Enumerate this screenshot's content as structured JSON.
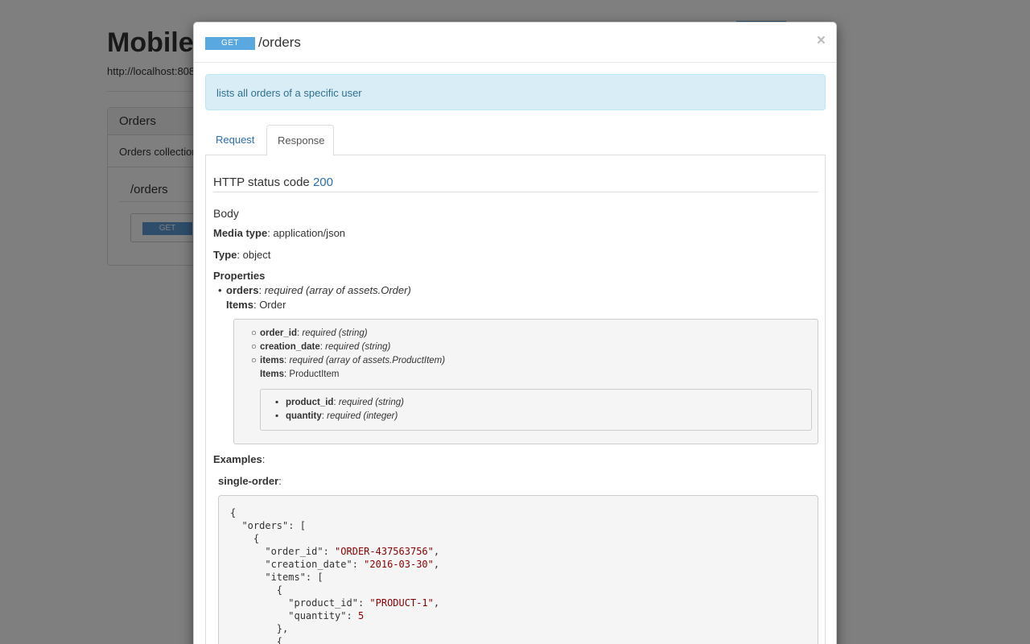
{
  "background": {
    "title": "Mobile",
    "base_url": "http://localhost:808",
    "panel_heading": "Orders",
    "panel_description": "Orders collection",
    "resource_path": "/orders",
    "method_badge": "GET"
  },
  "modal": {
    "method": "GET",
    "title": "/orders",
    "close_symbol": "×",
    "description": "lists all orders of a specific user",
    "tabs": [
      {
        "label": "Request",
        "active": false
      },
      {
        "label": "Response",
        "active": true
      }
    ],
    "response": {
      "status_label": "HTTP status code",
      "status_code": "200",
      "body_heading": "Body",
      "media_type_label": "Media type",
      "media_type_value": ": application/json",
      "type_label": "Type",
      "type_value": ": object",
      "properties_heading": "Properties",
      "properties": [
        {
          "name": "orders",
          "detail": "required (array of assets.Order)",
          "items_label": "Items",
          "items_value": ": Order"
        }
      ],
      "order_fields": [
        {
          "name": "order_id",
          "detail": "required (string)"
        },
        {
          "name": "creation_date",
          "detail": "required (string)"
        },
        {
          "name": "items",
          "detail": "required (array of assets.ProductItem)"
        }
      ],
      "order_items_label": "Items",
      "order_items_value": ": ProductItem",
      "product_fields": [
        {
          "name": "product_id",
          "detail": "required (string)"
        },
        {
          "name": "quantity",
          "detail": "required (integer)"
        }
      ],
      "examples_label": "Examples",
      "example_name": "single-order",
      "example_code": {
        "l1": "{",
        "l2_key": "  \"orders\"",
        "l2_rest": ": [",
        "l3": "    {",
        "l4_key": "      \"order_id\"",
        "l4_val": "\"ORDER-437563756\"",
        "l5_key": "      \"creation_date\"",
        "l5_val": "\"2016-03-30\"",
        "l6_key": "      \"items\"",
        "l6_rest": ": [",
        "l7": "        {",
        "l8_key": "          \"product_id\"",
        "l8_val": "\"PRODUCT-1\"",
        "l9_key": "          \"quantity\"",
        "l9_val": "5",
        "l10": "        },",
        "l11": "        {"
      }
    }
  },
  "colors": {
    "overlay": "rgba(0,0,0,0.5)",
    "method_get": "#5aa8e0",
    "link": "#2a6fb0",
    "alert_bg": "#d9edf7",
    "string_literal": "#880000"
  }
}
